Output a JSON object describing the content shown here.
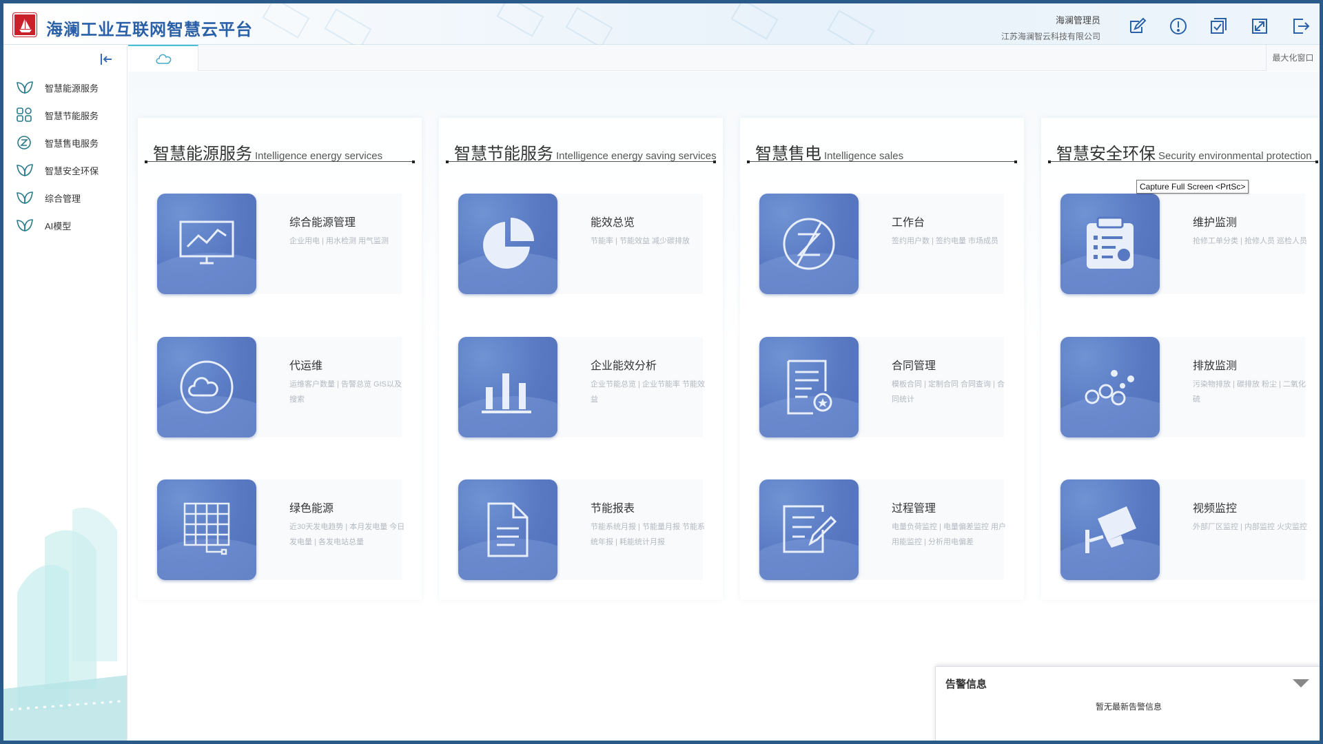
{
  "app": {
    "title": "海澜工业互联网智慧云平台",
    "user_name": "海澜管理员",
    "company": "江苏海澜智云科技有限公司"
  },
  "header_icons": [
    "edit-icon",
    "info-icon",
    "checklist-icon",
    "fullscreen-icon",
    "logout-icon"
  ],
  "sidebar": {
    "items": [
      {
        "label": "智慧能源服务",
        "icon": "leaf-icon"
      },
      {
        "label": "智慧节能服务",
        "icon": "grid-apps-icon"
      },
      {
        "label": "智慧售电服务",
        "icon": "z-circle-icon"
      },
      {
        "label": "智慧安全环保",
        "icon": "leaf-icon"
      },
      {
        "label": "综合管理",
        "icon": "leaf-icon"
      },
      {
        "label": "AI模型",
        "icon": "leaf-icon"
      }
    ]
  },
  "tabs": {
    "home_icon": "cloud-icon",
    "maximize_label": "最大化窗口"
  },
  "tooltip": "Capture Full Screen <PrtSc>",
  "panels": [
    {
      "title_cn": "智慧能源服务",
      "title_en": "Intelligence energy services",
      "cards": [
        {
          "title": "综合能源管理",
          "desc": "企业用电 | 用水检测 用气监测",
          "icon": "monitor-chart-icon"
        },
        {
          "title": "代运维",
          "desc": "运维客户数量 | 告警总览 GIS以及搜索",
          "icon": "cloud-icon"
        },
        {
          "title": "绿色能源",
          "desc": "近30天发电趋势 | 本月发电量 今日发电量 | 各发电站总量",
          "icon": "solar-panel-icon"
        }
      ]
    },
    {
      "title_cn": "智慧节能服务",
      "title_en": "Intelligence energy saving services",
      "cards": [
        {
          "title": "能效总览",
          "desc": "节能率 | 节能效益 减少碳排放",
          "icon": "pie-chart-icon"
        },
        {
          "title": "企业能效分析",
          "desc": "企业节能总览 | 企业节能率 节能效益",
          "icon": "bar-chart-icon"
        },
        {
          "title": "节能报表",
          "desc": "节能系统月报 | 节能量月报 节能系统年报 | 耗能统计月报",
          "icon": "document-icon"
        }
      ]
    },
    {
      "title_cn": "智慧售电",
      "title_en": "Intelligence  sales",
      "cards": [
        {
          "title": "工作台",
          "desc": "签约用户数 | 签约电量 市场成员",
          "icon": "z-circle-icon"
        },
        {
          "title": "合同管理",
          "desc": "模板合同 | 定制合同 合同查询 | 合同统计",
          "icon": "contract-icon"
        },
        {
          "title": "过程管理",
          "desc": "电量负荷监控 | 电量偏差监控 用户用能监控 | 分析用电偏差",
          "icon": "edit-document-icon"
        }
      ]
    },
    {
      "title_cn": "智慧安全环保",
      "title_en": "Security environmental protection",
      "cards": [
        {
          "title": "维护监测",
          "desc": "抢修工单分类 | 抢修人员 巡检人员",
          "icon": "clipboard-wrench-icon"
        },
        {
          "title": "排放监测",
          "desc": "污染物排放 | 碳排放 粉尘 | 二氧化硫",
          "icon": "bubbles-icon"
        },
        {
          "title": "视频监控",
          "desc": "外部厂区监控 | 内部监控 火灾监控",
          "icon": "camera-icon"
        }
      ]
    }
  ],
  "alert": {
    "title": "告警信息",
    "empty_text": "暂无最新告警信息"
  },
  "colors": {
    "brand_blue": "#2a60a8",
    "card_blue": "#5878c2",
    "tab_accent": "#47c1d6",
    "logo_red": "#c9202a"
  }
}
